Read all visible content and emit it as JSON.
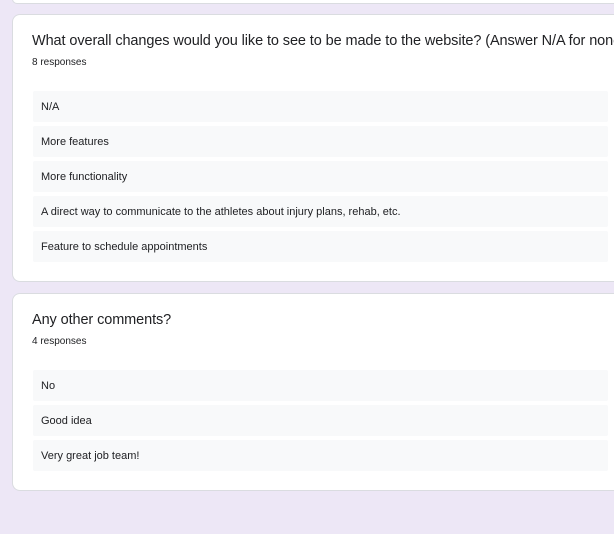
{
  "questions": [
    {
      "title": "What overall changes would you like to see to be made to the website? (Answer N/A for none)",
      "response_count": "8 responses",
      "responses": [
        "N/A",
        "More features",
        "More functionality",
        "A direct way to communicate to the athletes about injury plans, rehab, etc.",
        "Feature to schedule appointments"
      ]
    },
    {
      "title": "Any other comments?",
      "response_count": "4 responses",
      "responses": [
        "No",
        "Good idea",
        "Very great job team!"
      ]
    }
  ],
  "colors": {
    "page_background": "#ede7f6",
    "card_background": "#ffffff",
    "response_background": "#f8f9fa",
    "text": "#202124"
  }
}
